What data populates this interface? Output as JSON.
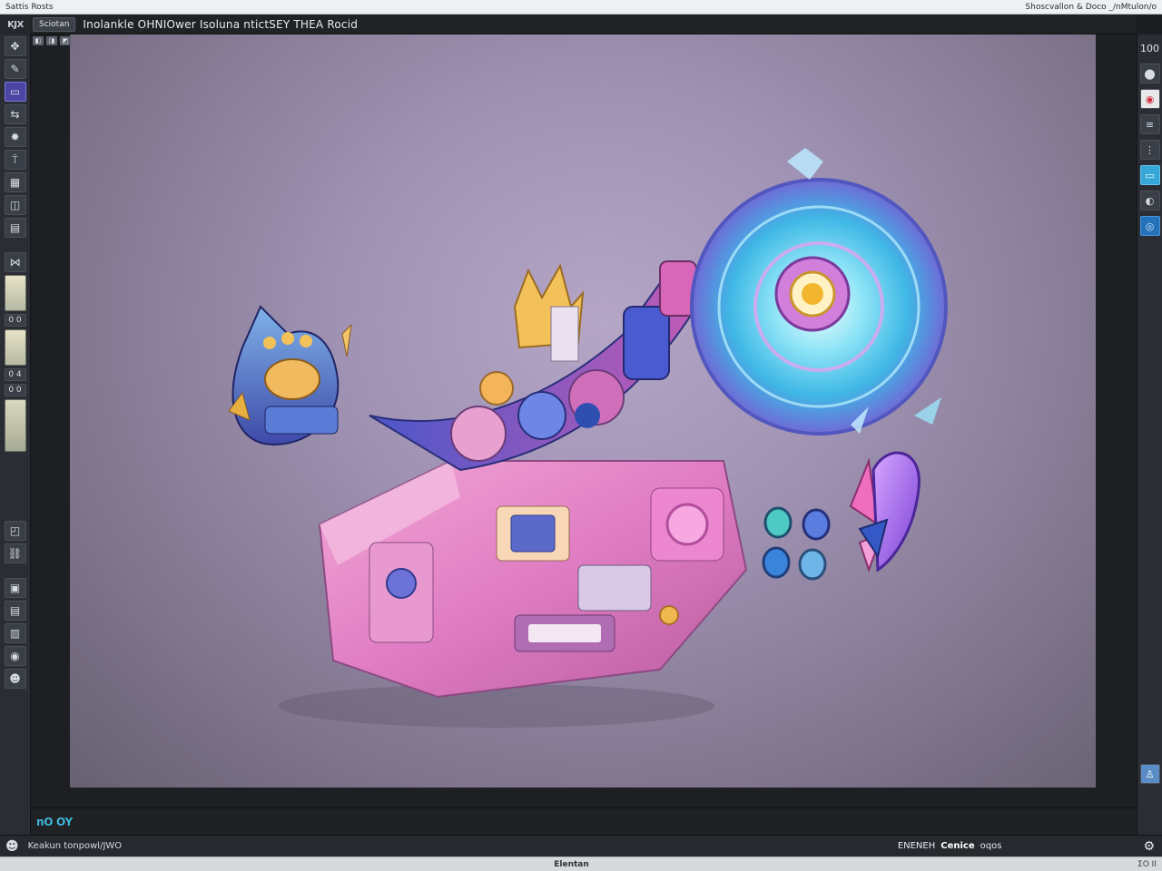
{
  "os_bar": {
    "left_text": "Sattis Rosts",
    "right_text": "Shoscvallon & Doco _/nMtulon/o"
  },
  "doc_bar": {
    "tab_label": "Sciotan",
    "title": "Inolankle OHNIOwer Isoluna ntictSEY THEA Rocid"
  },
  "corner_logo": "KJX",
  "viewport": {
    "mini_icons": [
      "◧",
      "◨",
      "◩"
    ]
  },
  "left_toolbar": {
    "tools": [
      {
        "name": "camera",
        "glyph": "✥"
      },
      {
        "name": "brush",
        "glyph": "✎"
      },
      {
        "name": "select",
        "glyph": "▭",
        "active": true
      },
      {
        "name": "move",
        "glyph": "⇆"
      },
      {
        "name": "gem",
        "glyph": "✹"
      },
      {
        "name": "pin",
        "glyph": "⍑"
      },
      {
        "name": "grid-a",
        "glyph": "▦"
      },
      {
        "name": "grid-b",
        "glyph": "◫"
      },
      {
        "name": "grid-c",
        "glyph": "▤"
      },
      {
        "name": "node",
        "glyph": "⋈"
      }
    ],
    "small_labels": [
      "0 0",
      "0 4",
      "0 0"
    ],
    "lower_tools": [
      {
        "name": "layers",
        "glyph": "◰"
      },
      {
        "name": "link",
        "glyph": "⛓"
      },
      {
        "name": "frame-a",
        "glyph": "▣"
      },
      {
        "name": "frame-b",
        "glyph": "▤"
      },
      {
        "name": "frame-c",
        "glyph": "▥"
      },
      {
        "name": "eye",
        "glyph": "◉"
      },
      {
        "name": "user",
        "glyph": "☻"
      }
    ]
  },
  "right_toolbar": {
    "zoom": "100",
    "tools": [
      {
        "name": "sphere",
        "glyph": "⬤"
      },
      {
        "name": "record",
        "glyph": "◉",
        "style": "red"
      },
      {
        "name": "layers",
        "glyph": "≡"
      },
      {
        "name": "sliders",
        "glyph": "⋮"
      },
      {
        "name": "preview",
        "glyph": "▭",
        "style": "blue"
      },
      {
        "name": "toggle",
        "glyph": "◐"
      },
      {
        "name": "globe",
        "glyph": "◎",
        "style": "blue2"
      }
    ],
    "bottom_tools": [
      {
        "name": "person",
        "glyph": "♙"
      },
      {
        "name": "settings",
        "glyph": "⚙"
      }
    ]
  },
  "status_top": {
    "badge": "nO OY"
  },
  "status_bottom": {
    "left_icon": "☻",
    "left_text": "Keakun tonpowl/JWO",
    "right_prefix": "ENENEH",
    "right_bold": "Cenice",
    "right_suffix": "oqos"
  },
  "footer": {
    "left": "",
    "center": "Elentan",
    "right": "ΣΟ ΙΙ"
  }
}
